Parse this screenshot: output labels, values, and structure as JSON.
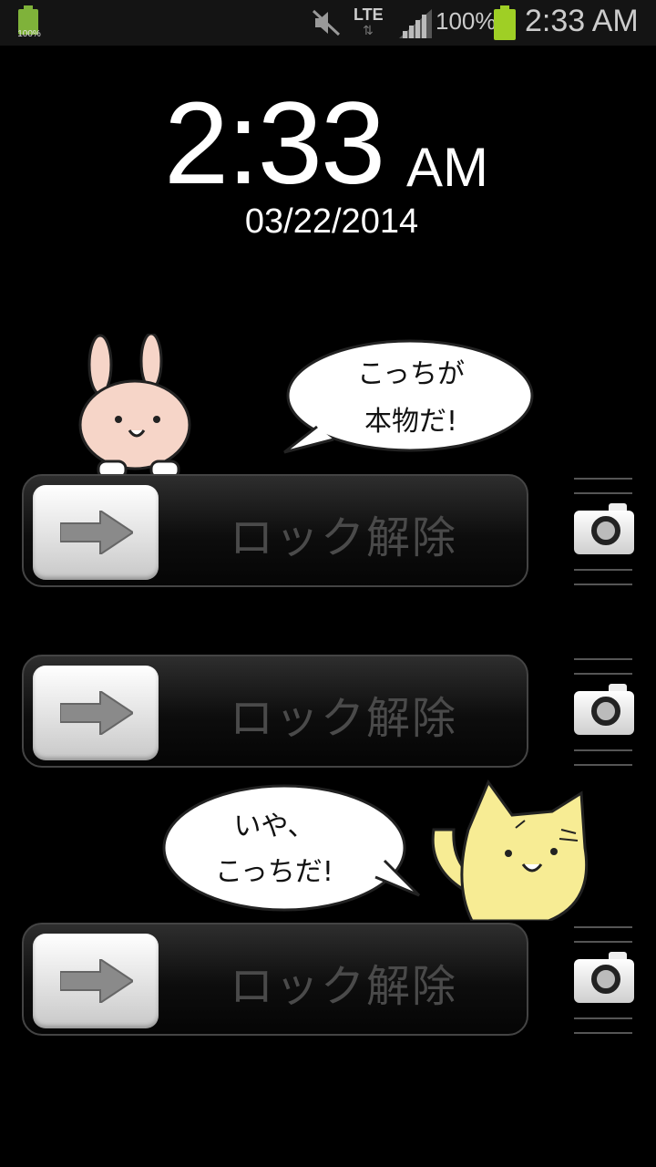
{
  "status_bar": {
    "small_battery_pct": "100%",
    "network": "LTE",
    "battery_pct": "100%",
    "time": "2:33 AM",
    "icons": [
      "battery-icon",
      "mute-icon",
      "lte-icon",
      "signal-icon",
      "battery-icon"
    ]
  },
  "clock": {
    "time": "2:33",
    "ampm": "AM",
    "date": "03/22/2014"
  },
  "bubbles": {
    "rabbit_line1": "こっちが",
    "rabbit_line2": "本物だ!",
    "cat_line1": "いや、",
    "cat_line2": "こっちだ!"
  },
  "sliders": [
    {
      "label": "ロック解除"
    },
    {
      "label": "ロック解除"
    },
    {
      "label": "ロック解除"
    }
  ],
  "colors": {
    "background": "#000000",
    "battery": "#9fcf25",
    "slider_label": "#4a4a4a"
  }
}
